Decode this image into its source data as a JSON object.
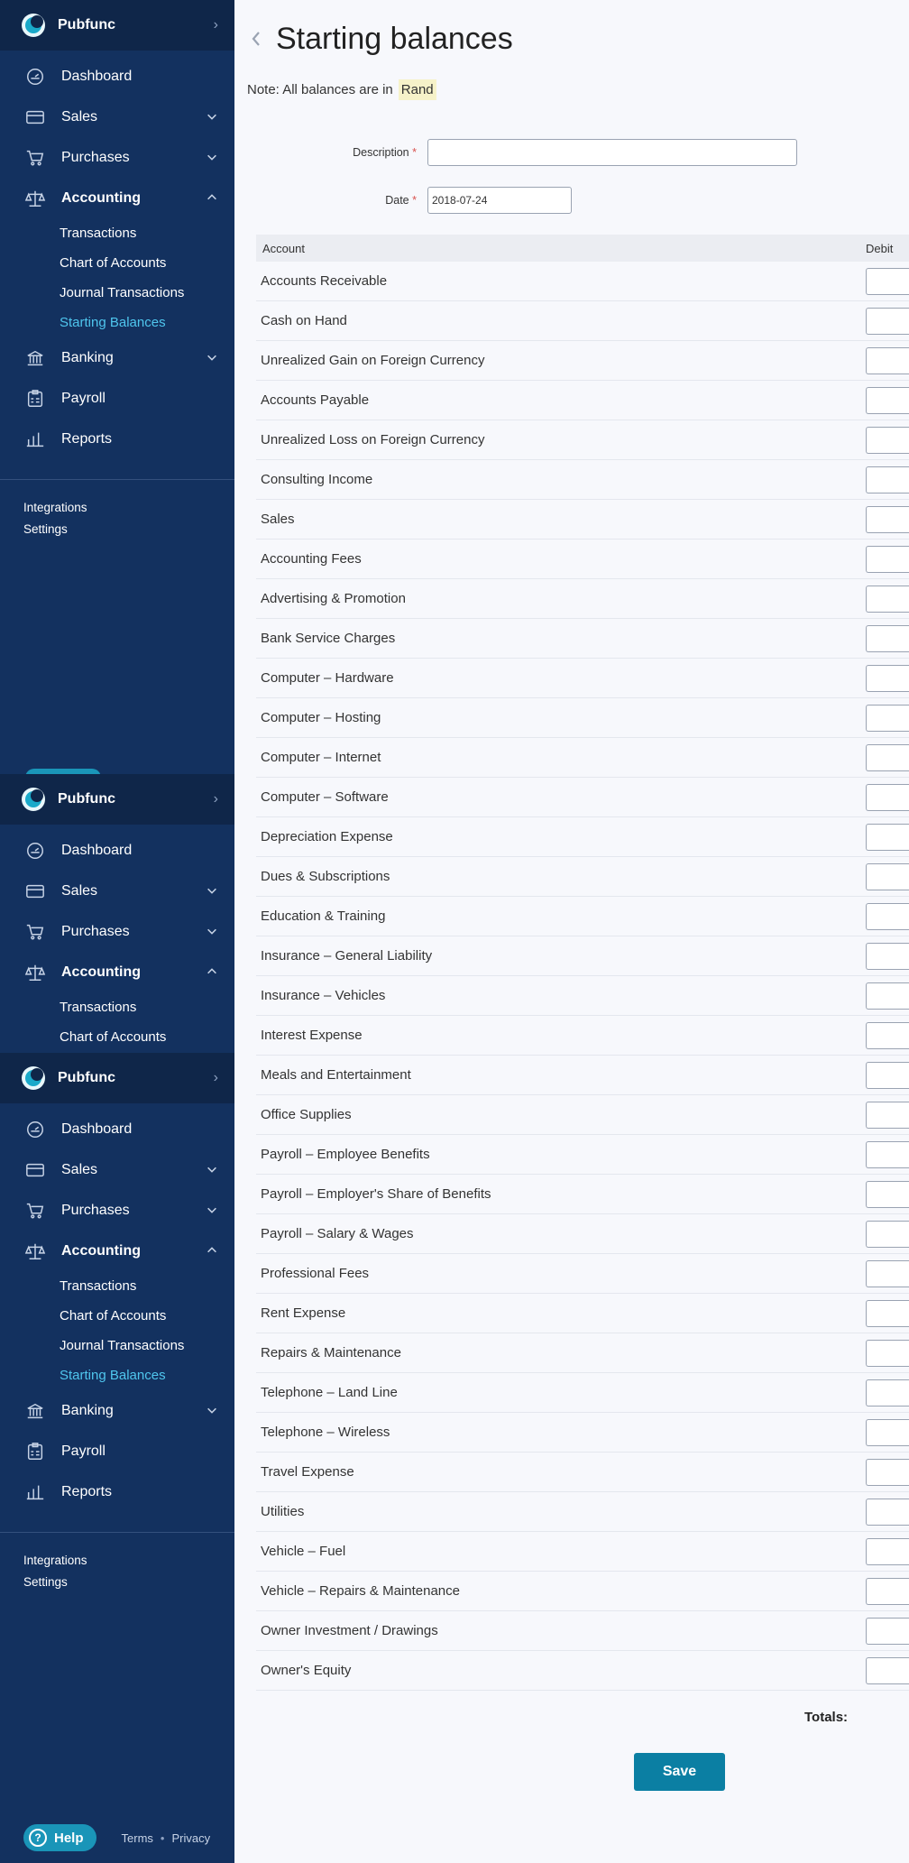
{
  "app": {
    "brand": "Pubfunc"
  },
  "nav": {
    "dashboard": "Dashboard",
    "sales": "Sales",
    "purchases": "Purchases",
    "accounting": "Accounting",
    "transactions": "Transactions",
    "chart_of_accounts": "Chart of Accounts",
    "journal_transactions": "Journal Transactions",
    "starting_balances": "Starting Balances",
    "banking": "Banking",
    "payroll": "Payroll",
    "reports": "Reports",
    "integrations": "Integrations",
    "settings": "Settings"
  },
  "footer": {
    "help": "Help",
    "terms": "Terms",
    "separator": "•",
    "privacy": "Privacy"
  },
  "page": {
    "title": "Starting balances",
    "note_prefix": "Note: All balances are in",
    "currency": "Rand",
    "description_label": "Description",
    "description_value": "",
    "date_label": "Date",
    "date_value": "2018-07-24",
    "required_mark": "*"
  },
  "table": {
    "col_account": "Account",
    "col_debit": "Debit",
    "rows": [
      "Accounts Receivable",
      "Cash on Hand",
      "Unrealized Gain on Foreign Currency",
      "Accounts Payable",
      "Unrealized Loss on Foreign Currency",
      "Consulting Income",
      "Sales",
      "Accounting Fees",
      "Advertising & Promotion",
      "Bank Service Charges",
      "Computer – Hardware",
      "Computer – Hosting",
      "Computer – Internet",
      "Computer – Software",
      "Depreciation Expense",
      "Dues & Subscriptions",
      "Education & Training",
      "Insurance – General Liability",
      "Insurance – Vehicles",
      "Interest Expense",
      "Meals and Entertainment",
      "Office Supplies",
      "Payroll – Employee Benefits",
      "Payroll – Employer's Share of Benefits",
      "Payroll – Salary & Wages",
      "Professional Fees",
      "Rent Expense",
      "Repairs & Maintenance",
      "Telephone – Land Line",
      "Telephone – Wireless",
      "Travel Expense",
      "Utilities",
      "Vehicle – Fuel",
      "Vehicle – Repairs & Maintenance",
      "Owner Investment / Drawings",
      "Owner's Equity"
    ],
    "totals_label": "Totals:"
  },
  "actions": {
    "save": "Save"
  },
  "colors": {
    "sidebar": "#13315f",
    "sidebar_header": "#0f2649",
    "active_link": "#4fc6ee",
    "primary_button": "#0b7fa3"
  }
}
